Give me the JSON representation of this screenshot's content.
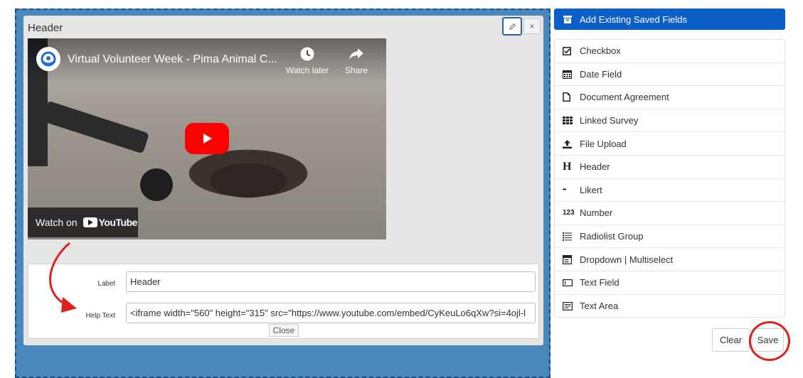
{
  "field": {
    "title": "Header",
    "edit_icon": "pencil-icon",
    "close_icon": "×"
  },
  "video": {
    "title": "Virtual Volunteer Week - Pima Animal C...",
    "watch_later": "Watch later",
    "share": "Share",
    "watch_on": "Watch on",
    "youtube_logo": "YouTube"
  },
  "settings": {
    "label_caption": "Label",
    "label_value": "Header",
    "help_caption": "Help Text",
    "help_value": "<iframe width=\"560\" height=\"315\" src=\"https://www.youtube.com/embed/CyKeuLo6qXw?si=4ojl-l",
    "close_label": "Close"
  },
  "sidebar": {
    "add_existing": "Add Existing Saved Fields",
    "items": [
      {
        "label": "Checkbox",
        "icon": "checkbox-icon"
      },
      {
        "label": "Date Field",
        "icon": "calendar-icon"
      },
      {
        "label": "Document Agreement",
        "icon": "document-icon"
      },
      {
        "label": "Linked Survey",
        "icon": "grid-icon"
      },
      {
        "label": "File Upload",
        "icon": "upload-icon"
      },
      {
        "label": "Header",
        "icon": "header-icon"
      },
      {
        "label": "Likert",
        "icon": "ellipsis-icon"
      },
      {
        "label": "Number",
        "icon": "number-icon"
      },
      {
        "label": "Radiolist Group",
        "icon": "list-icon"
      },
      {
        "label": "Dropdown | Multiselect",
        "icon": "dropdown-icon"
      },
      {
        "label": "Text Field",
        "icon": "textfield-icon"
      },
      {
        "label": "Text Area",
        "icon": "textarea-icon"
      }
    ],
    "clear_label": "Clear",
    "save_label": "Save"
  },
  "icon_glyphs": {
    "header": "H",
    "ellipsis": "•••",
    "number": "123"
  },
  "colors": {
    "canvas": "#4a87bd",
    "primary_button": "#0b5fc7",
    "annotation": "#e02020",
    "youtube_red": "#ff0000"
  }
}
